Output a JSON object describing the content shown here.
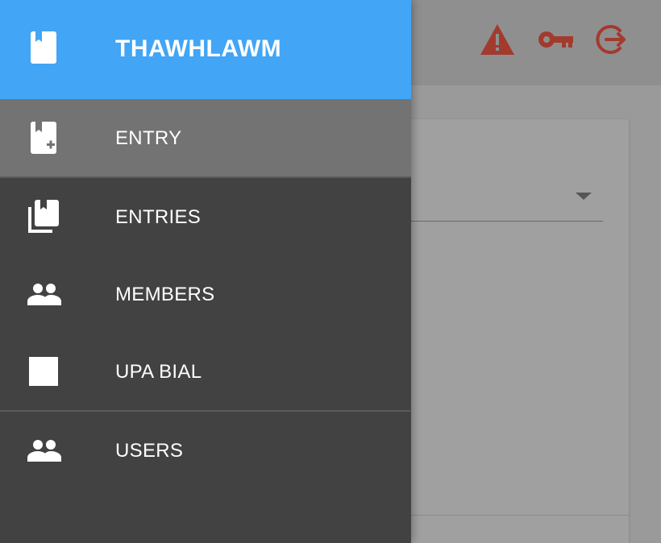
{
  "drawer": {
    "header": {
      "title": "THAWHLAWM",
      "icon": "book-icon"
    },
    "items": [
      {
        "label": "ENTRY",
        "icon": "book-add-icon",
        "active": true
      },
      {
        "label": "ENTRIES",
        "icon": "library-books-icon",
        "active": false
      },
      {
        "label": "MEMBERS",
        "icon": "people-icon",
        "active": false
      },
      {
        "label": "UPA BIAL",
        "icon": "square-icon",
        "active": false
      },
      {
        "label": "USERS",
        "icon": "people-icon",
        "active": false
      }
    ]
  },
  "app_bar": {
    "actions": [
      {
        "icon": "warning-icon"
      },
      {
        "icon": "key-icon"
      },
      {
        "icon": "logout-icon"
      }
    ]
  },
  "colors": {
    "header_bg": "#42a5f5",
    "drawer_bg": "#424242",
    "active_item_bg": "#737373",
    "action_icon": "#a33a2e"
  }
}
